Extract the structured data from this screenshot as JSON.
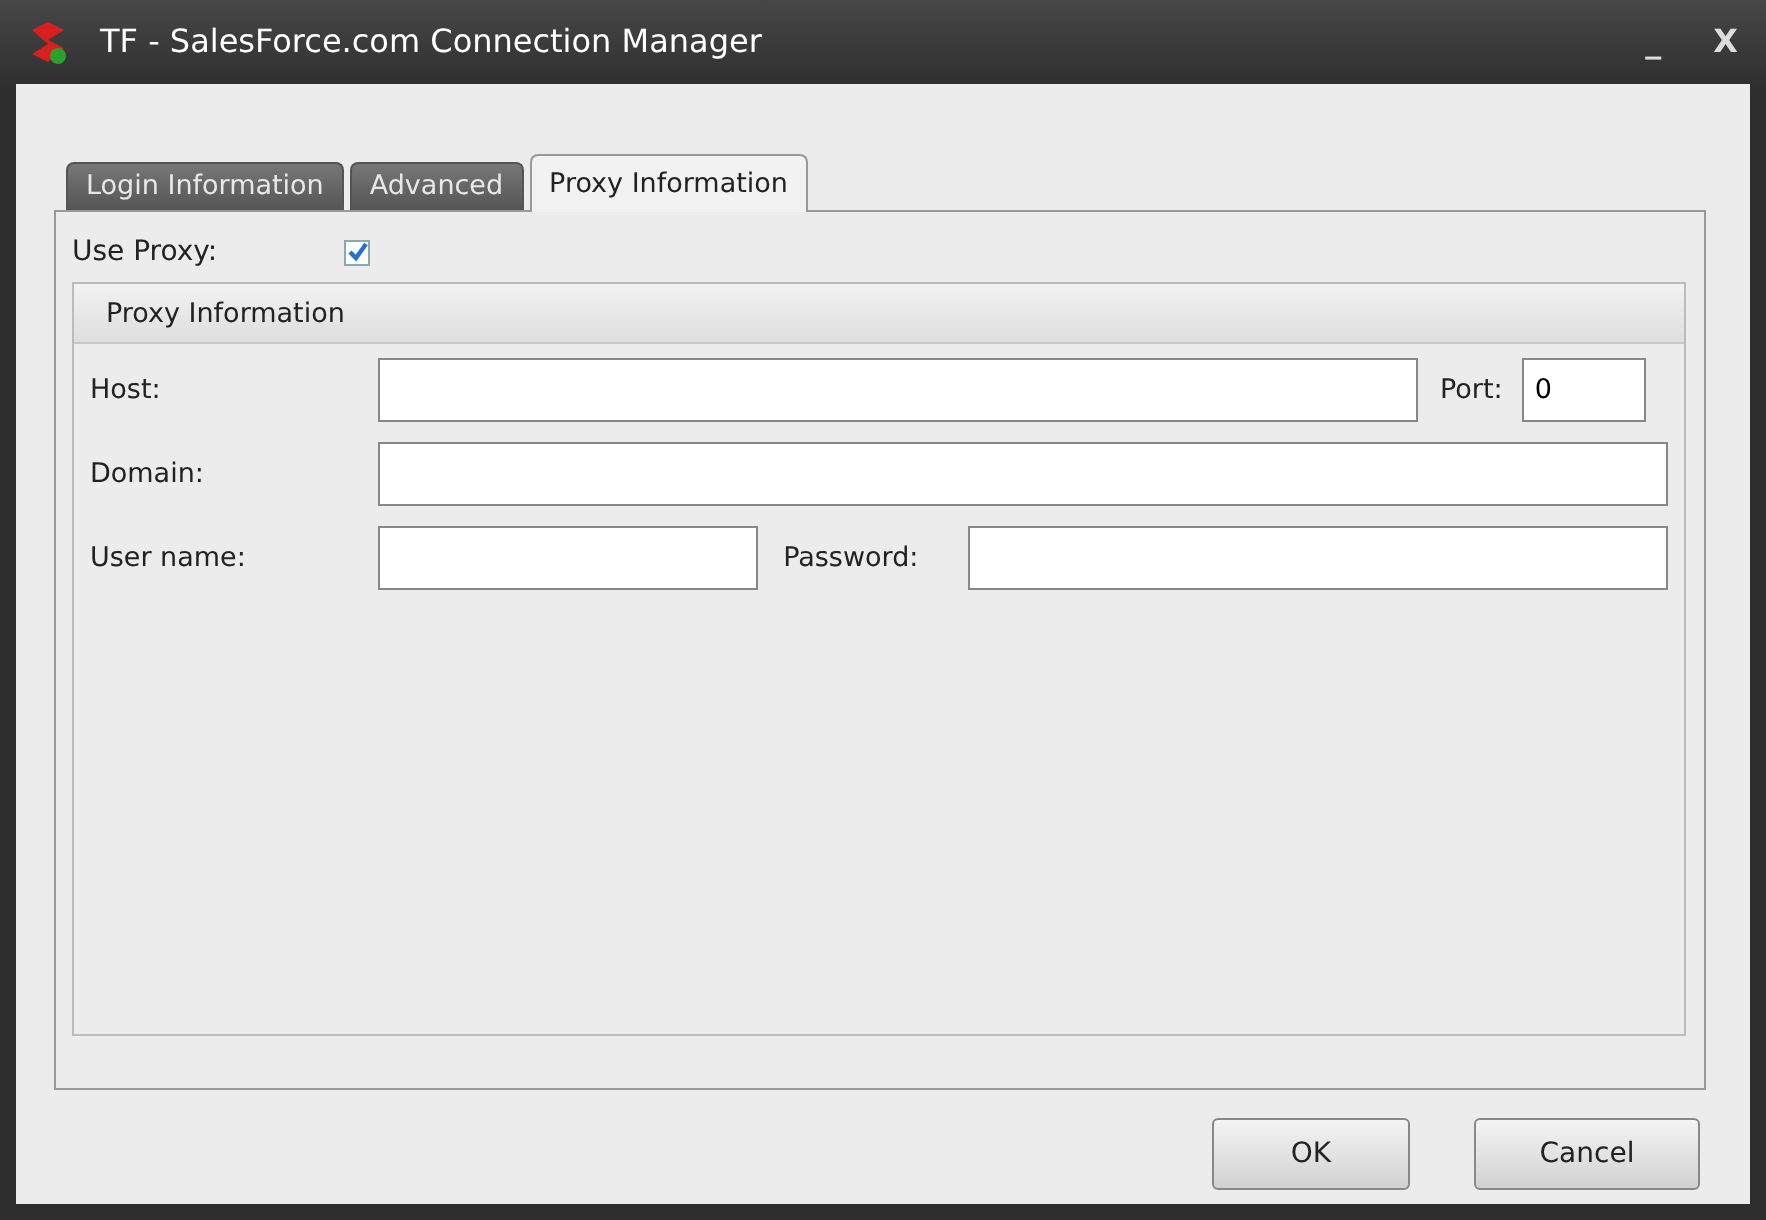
{
  "window": {
    "title": "TF - SalesForce.com Connection Manager",
    "controls": [
      "_",
      "X"
    ]
  },
  "tabs": [
    {
      "label": "Login Information",
      "selected": false
    },
    {
      "label": "Advanced",
      "selected": false
    },
    {
      "label": "Proxy Information",
      "selected": true
    }
  ],
  "use_proxy": {
    "label": "Use Proxy:",
    "checked": true
  },
  "group": {
    "title": "Proxy Information",
    "host": {
      "label": "Host:"
    },
    "port": {
      "label": "Port:",
      "value": "0"
    },
    "domain": {
      "label": "Domain:"
    },
    "user_name": {
      "label": "User name:"
    },
    "password": {
      "label": "Password:"
    }
  },
  "buttons": [
    "OK",
    "Cancel"
  ]
}
